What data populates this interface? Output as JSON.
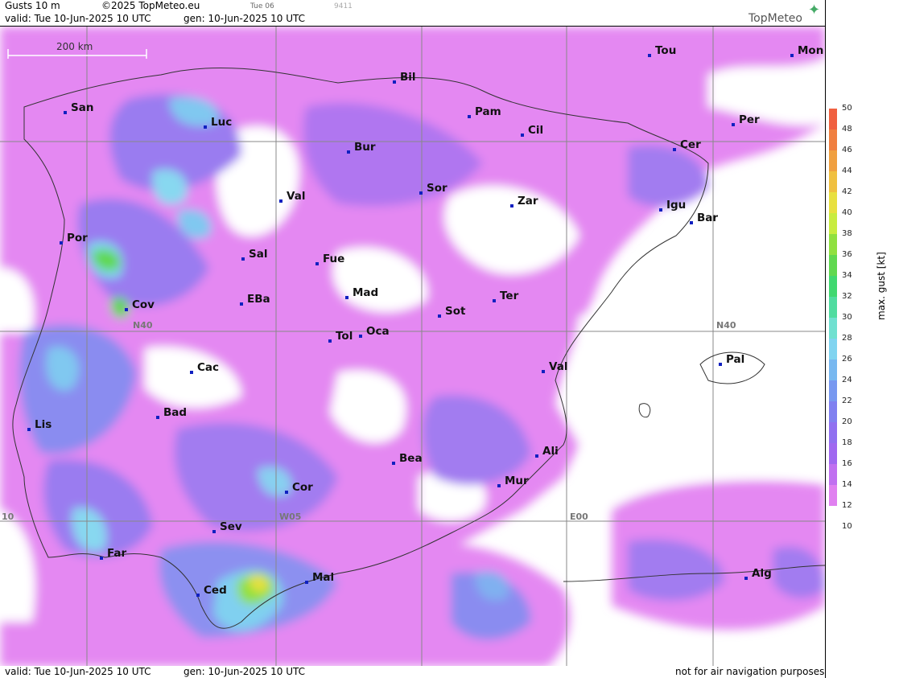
{
  "header": {
    "title": "Gusts 10 m",
    "copyright": "©2025 TopMeteo.eu",
    "model_time": "Tue 06",
    "code": "9411",
    "valid": "valid:  Tue  10-Jun-2025  10 UTC",
    "gen": "gen: 10-Jun-2025 10 UTC",
    "logo": "TopMeteo"
  },
  "scale_bar": "200 km",
  "grid_labels": {
    "n40_west": "N40",
    "n40_east": "N40",
    "w05": "W05",
    "e00": "E00",
    "w10": "10"
  },
  "cities": [
    {
      "name": "San"
    },
    {
      "name": "Luc"
    },
    {
      "name": "Bil"
    },
    {
      "name": "Pam"
    },
    {
      "name": "Cil"
    },
    {
      "name": "Tou"
    },
    {
      "name": "Mon"
    },
    {
      "name": "Per"
    },
    {
      "name": "Cer"
    },
    {
      "name": "Bur"
    },
    {
      "name": "Sor"
    },
    {
      "name": "Zar"
    },
    {
      "name": "Igu"
    },
    {
      "name": "Bar"
    },
    {
      "name": "Val"
    },
    {
      "name": "Por"
    },
    {
      "name": "Sal"
    },
    {
      "name": "Fue"
    },
    {
      "name": "Mad"
    },
    {
      "name": "EBa"
    },
    {
      "name": "Cov"
    },
    {
      "name": "Tol"
    },
    {
      "name": "Oca"
    },
    {
      "name": "Sot"
    },
    {
      "name": "Ter"
    },
    {
      "name": "Cac"
    },
    {
      "name": "Val"
    },
    {
      "name": "Pal"
    },
    {
      "name": "Bad"
    },
    {
      "name": "Lis"
    },
    {
      "name": "Bea"
    },
    {
      "name": "Ali"
    },
    {
      "name": "Mur"
    },
    {
      "name": "Cor"
    },
    {
      "name": "Sev"
    },
    {
      "name": "Far"
    },
    {
      "name": "Mal"
    },
    {
      "name": "Alg"
    },
    {
      "name": "Ced"
    }
  ],
  "legend": {
    "title": "max. gust [kt]",
    "ticks": [
      "50",
      "48",
      "46",
      "44",
      "42",
      "40",
      "38",
      "36",
      "34",
      "32",
      "30",
      "28",
      "26",
      "24",
      "22",
      "20",
      "18",
      "16",
      "14",
      "12",
      "10"
    ],
    "colors": [
      "#f06040",
      "#f07f40",
      "#f0a040",
      "#f0c040",
      "#e8e040",
      "#c8ec40",
      "#90e040",
      "#60d850",
      "#40d870",
      "#50dca0",
      "#70e0d0",
      "#80d4f0",
      "#78b8f0",
      "#7898f0",
      "#8080f0",
      "#9070f0",
      "#a068f0",
      "#c070f0",
      "#e080f0"
    ]
  },
  "footer": {
    "valid": "valid:  Tue  10-Jun-2025  10 UTC",
    "gen": "gen: 10-Jun-2025 10 UTC",
    "disclaimer": "not for air navigation purposes"
  }
}
